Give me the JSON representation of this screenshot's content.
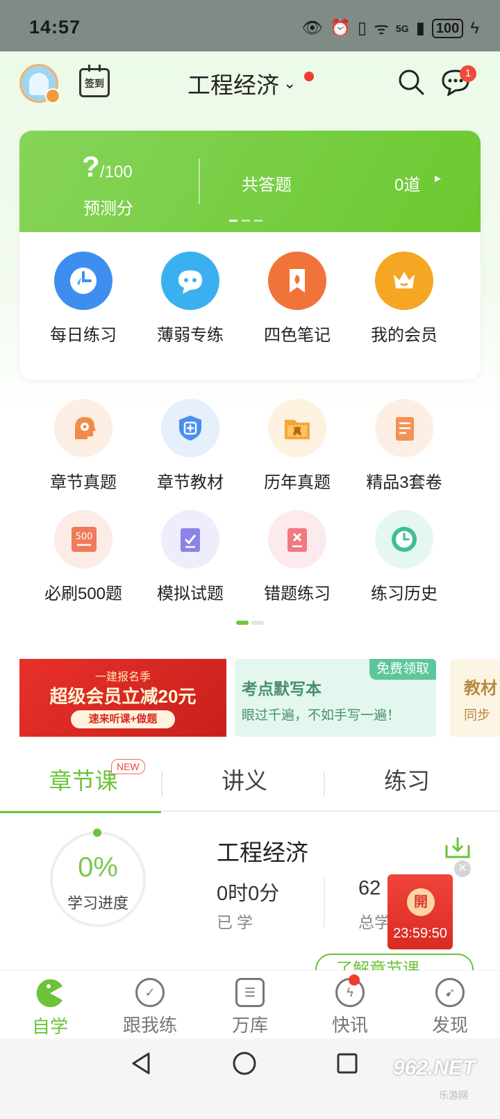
{
  "status_bar": {
    "time": "14:57",
    "battery": "100",
    "network": "5G"
  },
  "header": {
    "subject": "工程经济",
    "checkin_label": "签到",
    "message_badge": "1"
  },
  "score_card": {
    "predicted_score": "?",
    "max_score": "/100",
    "predicted_label": "预测分",
    "answered_label": "共答题",
    "answered_count": "0道",
    "quick_actions": [
      {
        "label": "每日练习",
        "icon": "clock-icon",
        "color": "#3e8ef0"
      },
      {
        "label": "薄弱专练",
        "icon": "chat-bubble-icon",
        "color": "#3ab0f0"
      },
      {
        "label": "四色笔记",
        "icon": "flame-bookmark-icon",
        "color": "#f0733a"
      },
      {
        "label": "我的会员",
        "icon": "crown-icon",
        "color": "#f5a623"
      }
    ]
  },
  "grid": [
    {
      "label": "章节真题",
      "icon": "gear-head-icon",
      "color": "#f28b4a",
      "bg": "#fdeee4"
    },
    {
      "label": "章节教材",
      "icon": "shield-icon",
      "color": "#4a8ef0",
      "bg": "#e6effc"
    },
    {
      "label": "历年真题",
      "icon": "folder-icon",
      "color": "#f5a73a",
      "bg": "#fdf1e0"
    },
    {
      "label": "精品3套卷",
      "icon": "checklist-icon",
      "color": "#f39257",
      "bg": "#fdeee4"
    },
    {
      "label": "必刷500题",
      "icon": "500-badge-icon",
      "color": "#f07a5a",
      "bg": "#fdece6"
    },
    {
      "label": "模拟试题",
      "icon": "scroll-check-icon",
      "color": "#8b84e8",
      "bg": "#eeedfc"
    },
    {
      "label": "错题练习",
      "icon": "x-card-icon",
      "color": "#f07a82",
      "bg": "#fdeaec"
    },
    {
      "label": "练习历史",
      "icon": "clock-icon",
      "color": "#3dbf94",
      "bg": "#e4f7f0"
    }
  ],
  "banners": [
    {
      "line1": "一建报名季",
      "line2": "超级会员立减20元",
      "line3": "速来听课+做题"
    },
    {
      "tag": "免费领取",
      "title": "考点默写本",
      "subtitle": "眼过千遍，不如手写一遍！"
    },
    {
      "title": "教材",
      "subtitle": "同步"
    }
  ],
  "tabs": [
    {
      "label": "章节课",
      "badge": "NEW"
    },
    {
      "label": "讲义"
    },
    {
      "label": "练习"
    }
  ],
  "course": {
    "title": "工程经济",
    "progress_pct": "0%",
    "progress_label": "学习进度",
    "studied_value": "0时0分",
    "studied_label": "已学",
    "total_value": "62",
    "total_label": "总学",
    "learn_button": "了解章节课"
  },
  "promo": {
    "coin_char": "開",
    "timer": "23:59:50"
  },
  "bottom_nav": [
    {
      "label": "自学",
      "icon": "pacman-icon"
    },
    {
      "label": "跟我练",
      "icon": "check-bubble-icon"
    },
    {
      "label": "万库",
      "icon": "document-icon"
    },
    {
      "label": "快讯",
      "icon": "lightning-icon"
    },
    {
      "label": "发现",
      "icon": "compass-icon"
    }
  ],
  "watermark": {
    "text": "962.NET",
    "sub": "乐游网"
  }
}
